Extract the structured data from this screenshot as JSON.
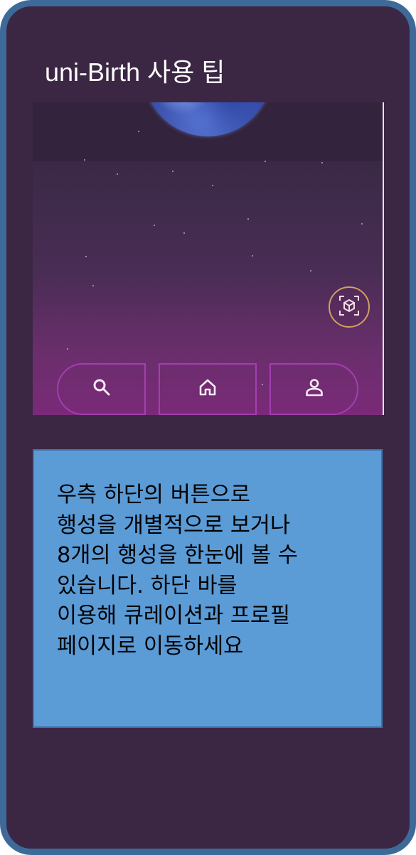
{
  "dialog": {
    "title": "uni-Birth 사용 팁"
  },
  "preview": {
    "ar_button_icon": "ar-cube-icon",
    "nav": {
      "search_icon": "search-icon",
      "home_icon": "home-icon",
      "profile_icon": "profile-icon"
    },
    "colors": {
      "nav_border": "#a23fb0",
      "ar_border": "#d0a060"
    }
  },
  "tip": {
    "text": "우측 하단의 버튼으로\n행성을 개별적으로 보거나\n8개의 행성을 한눈에 볼 수\n있습니다. 하단 바를\n이용해 큐레이션과 프로필\n페이지로 이동하세요"
  }
}
